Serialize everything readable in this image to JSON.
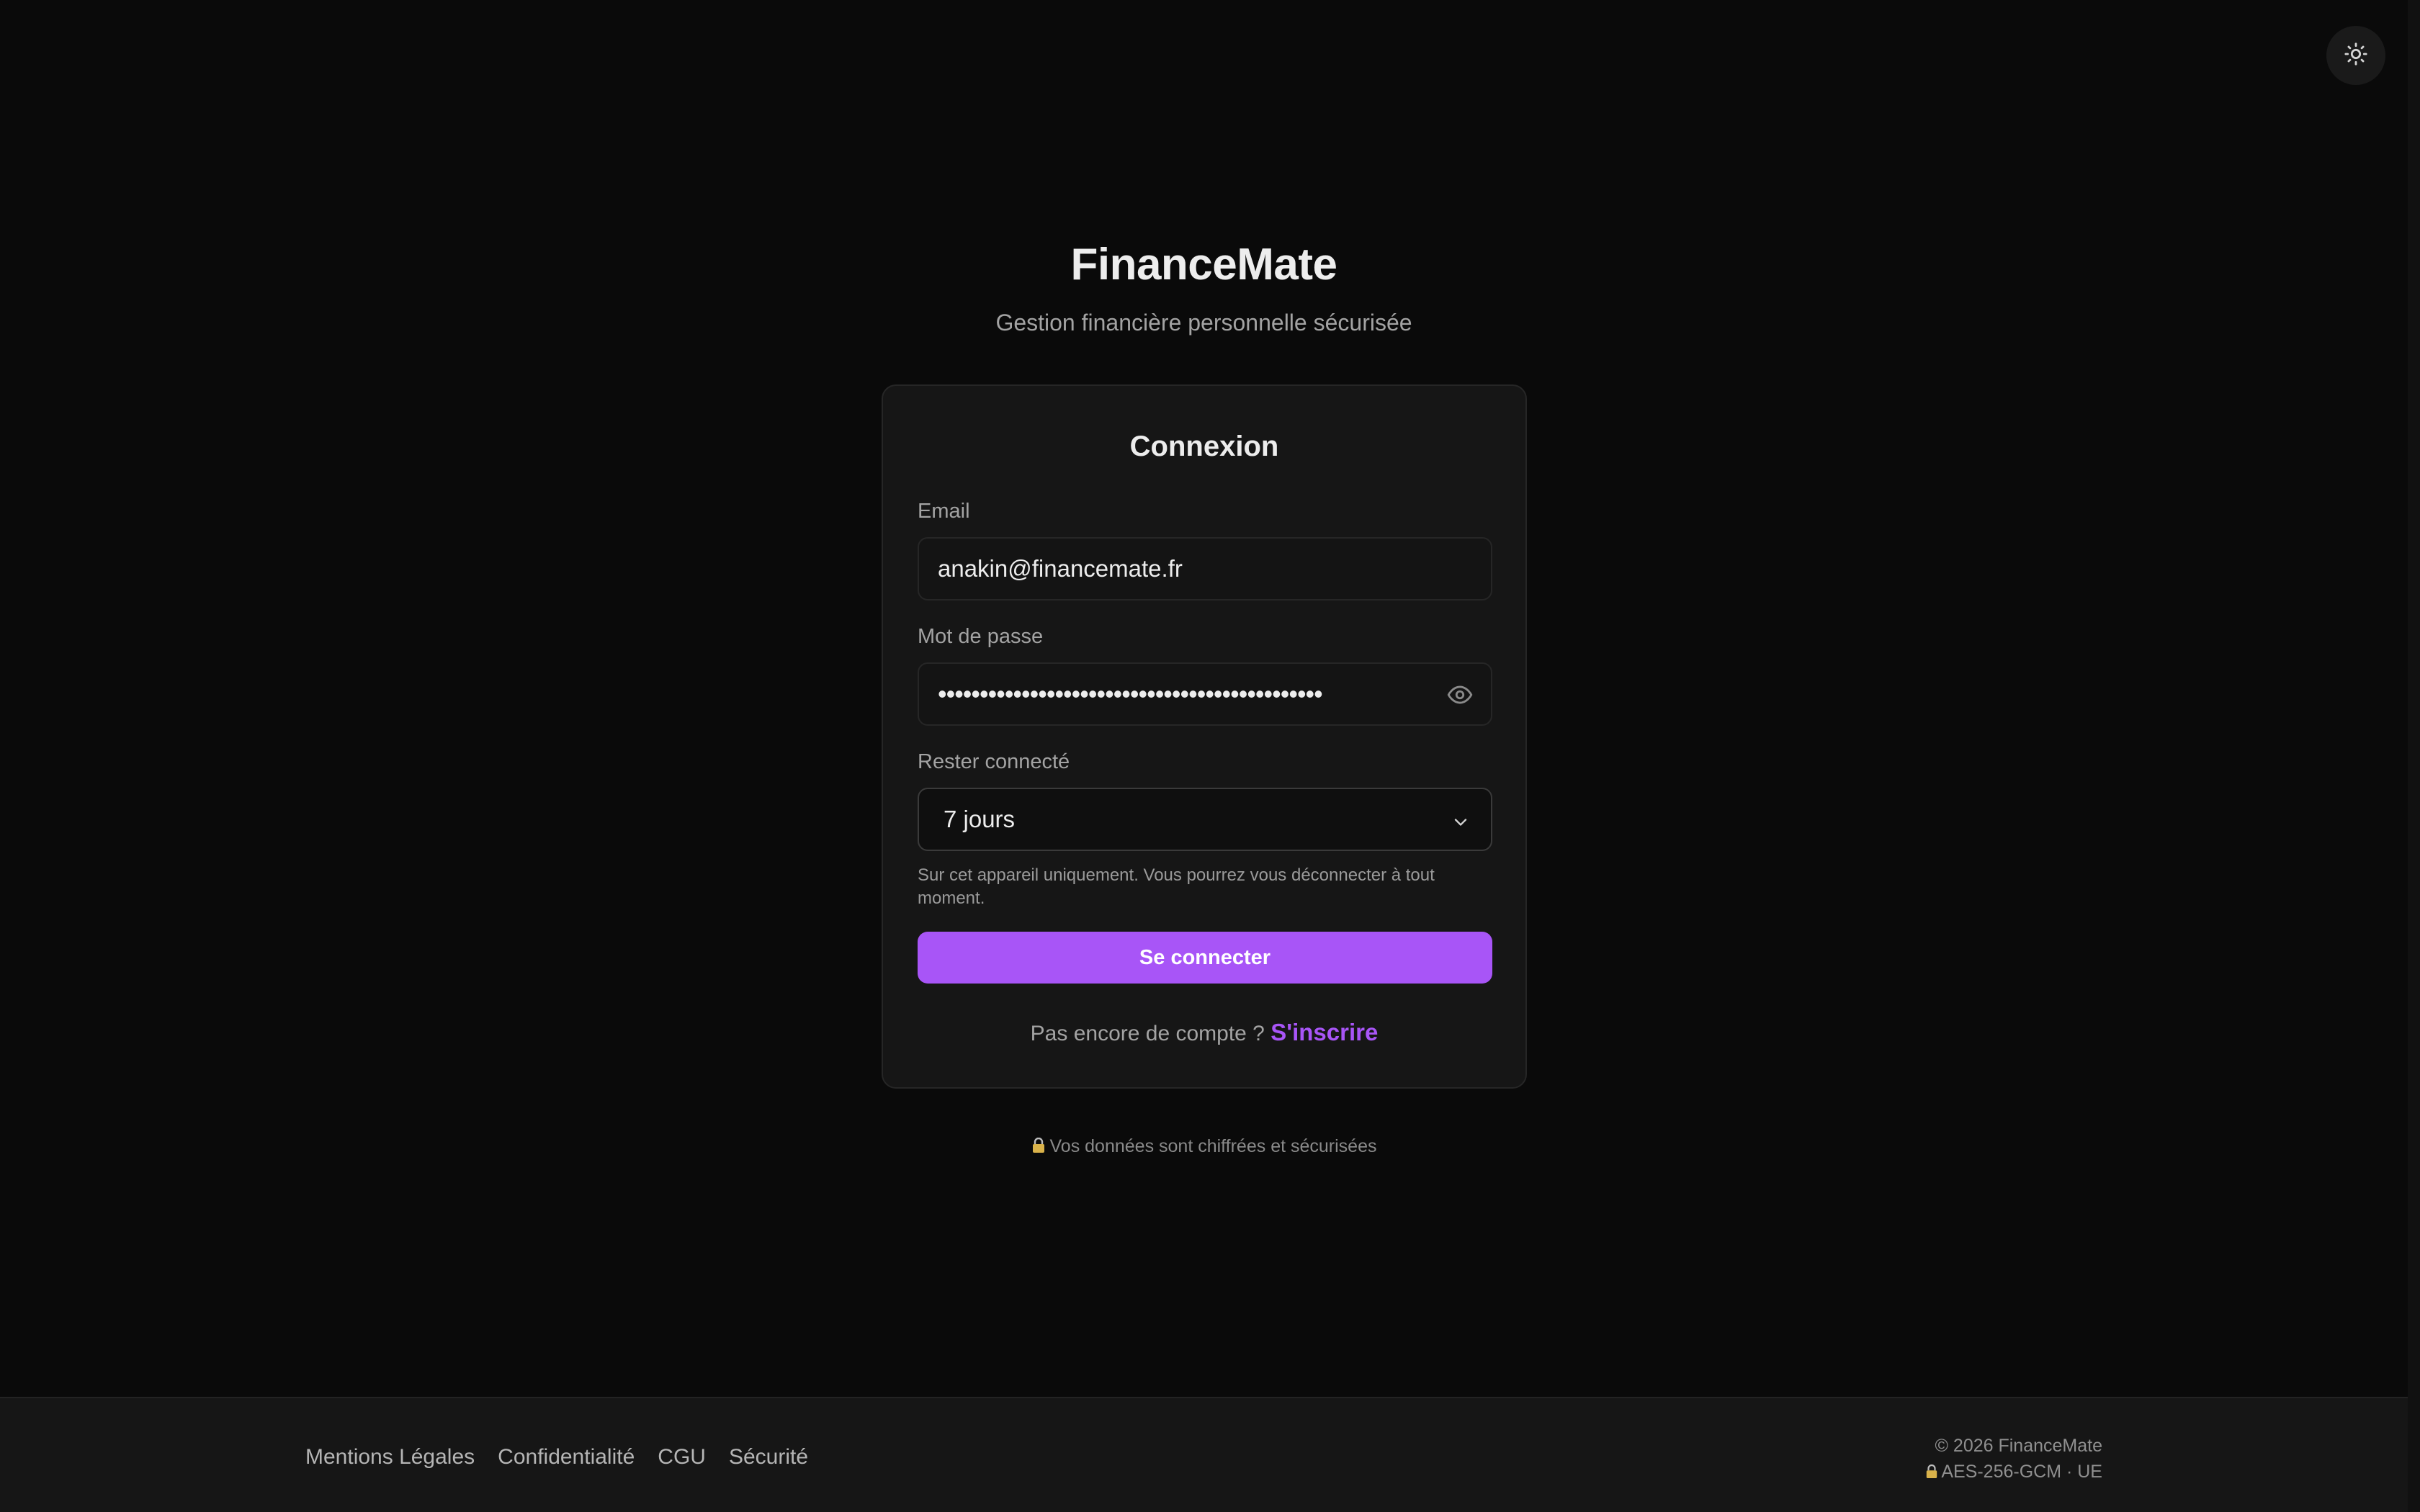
{
  "theme_toggle": {
    "icon": "sun-icon"
  },
  "brand": {
    "title": "FinanceMate",
    "subtitle": "Gestion financière personnelle sécurisée"
  },
  "login": {
    "title": "Connexion",
    "email": {
      "label": "Email",
      "value": "anakin@financemate.fr"
    },
    "password": {
      "label": "Mot de passe",
      "masked_value": "••••••••••••••••••••••••••••••••••••••••••••••",
      "toggle_icon": "eye-icon"
    },
    "remember": {
      "label": "Rester connecté",
      "selected": "7 jours",
      "hint": "Sur cet appareil uniquement. Vous pourrez vous déconnecter à tout moment."
    },
    "submit_label": "Se connecter",
    "signup_prompt": "Pas encore de compte ?",
    "signup_link": "S'inscrire"
  },
  "secure_note": "Vos données sont chiffrées et sécurisées",
  "footer": {
    "links": [
      "Mentions Légales",
      "Confidentialité",
      "CGU",
      "Sécurité"
    ],
    "copyright": "© 2026 FinanceMate",
    "encryption": "AES-256-GCM · UE"
  },
  "colors": {
    "background": "#0a0a0a",
    "card": "#161616",
    "accent": "#a855f7",
    "text": "#ededed",
    "muted": "#a3a3a3"
  }
}
